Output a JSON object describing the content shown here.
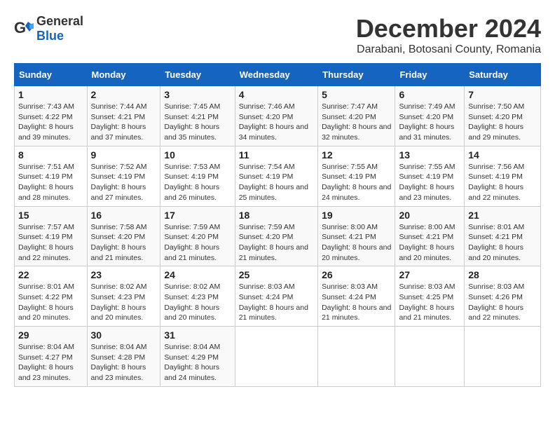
{
  "logo": {
    "text_general": "General",
    "text_blue": "Blue"
  },
  "title": "December 2024",
  "subtitle": "Darabani, Botosani County, Romania",
  "headers": [
    "Sunday",
    "Monday",
    "Tuesday",
    "Wednesday",
    "Thursday",
    "Friday",
    "Saturday"
  ],
  "weeks": [
    [
      {
        "day": "1",
        "sunrise": "7:43 AM",
        "sunset": "4:22 PM",
        "daylight": "8 hours and 39 minutes."
      },
      {
        "day": "2",
        "sunrise": "7:44 AM",
        "sunset": "4:21 PM",
        "daylight": "8 hours and 37 minutes."
      },
      {
        "day": "3",
        "sunrise": "7:45 AM",
        "sunset": "4:21 PM",
        "daylight": "8 hours and 35 minutes."
      },
      {
        "day": "4",
        "sunrise": "7:46 AM",
        "sunset": "4:20 PM",
        "daylight": "8 hours and 34 minutes."
      },
      {
        "day": "5",
        "sunrise": "7:47 AM",
        "sunset": "4:20 PM",
        "daylight": "8 hours and 32 minutes."
      },
      {
        "day": "6",
        "sunrise": "7:49 AM",
        "sunset": "4:20 PM",
        "daylight": "8 hours and 31 minutes."
      },
      {
        "day": "7",
        "sunrise": "7:50 AM",
        "sunset": "4:20 PM",
        "daylight": "8 hours and 29 minutes."
      }
    ],
    [
      {
        "day": "8",
        "sunrise": "7:51 AM",
        "sunset": "4:19 PM",
        "daylight": "8 hours and 28 minutes."
      },
      {
        "day": "9",
        "sunrise": "7:52 AM",
        "sunset": "4:19 PM",
        "daylight": "8 hours and 27 minutes."
      },
      {
        "day": "10",
        "sunrise": "7:53 AM",
        "sunset": "4:19 PM",
        "daylight": "8 hours and 26 minutes."
      },
      {
        "day": "11",
        "sunrise": "7:54 AM",
        "sunset": "4:19 PM",
        "daylight": "8 hours and 25 minutes."
      },
      {
        "day": "12",
        "sunrise": "7:55 AM",
        "sunset": "4:19 PM",
        "daylight": "8 hours and 24 minutes."
      },
      {
        "day": "13",
        "sunrise": "7:55 AM",
        "sunset": "4:19 PM",
        "daylight": "8 hours and 23 minutes."
      },
      {
        "day": "14",
        "sunrise": "7:56 AM",
        "sunset": "4:19 PM",
        "daylight": "8 hours and 22 minutes."
      }
    ],
    [
      {
        "day": "15",
        "sunrise": "7:57 AM",
        "sunset": "4:19 PM",
        "daylight": "8 hours and 22 minutes."
      },
      {
        "day": "16",
        "sunrise": "7:58 AM",
        "sunset": "4:20 PM",
        "daylight": "8 hours and 21 minutes."
      },
      {
        "day": "17",
        "sunrise": "7:59 AM",
        "sunset": "4:20 PM",
        "daylight": "8 hours and 21 minutes."
      },
      {
        "day": "18",
        "sunrise": "7:59 AM",
        "sunset": "4:20 PM",
        "daylight": "8 hours and 21 minutes."
      },
      {
        "day": "19",
        "sunrise": "8:00 AM",
        "sunset": "4:21 PM",
        "daylight": "8 hours and 20 minutes."
      },
      {
        "day": "20",
        "sunrise": "8:00 AM",
        "sunset": "4:21 PM",
        "daylight": "8 hours and 20 minutes."
      },
      {
        "day": "21",
        "sunrise": "8:01 AM",
        "sunset": "4:21 PM",
        "daylight": "8 hours and 20 minutes."
      }
    ],
    [
      {
        "day": "22",
        "sunrise": "8:01 AM",
        "sunset": "4:22 PM",
        "daylight": "8 hours and 20 minutes."
      },
      {
        "day": "23",
        "sunrise": "8:02 AM",
        "sunset": "4:23 PM",
        "daylight": "8 hours and 20 minutes."
      },
      {
        "day": "24",
        "sunrise": "8:02 AM",
        "sunset": "4:23 PM",
        "daylight": "8 hours and 20 minutes."
      },
      {
        "day": "25",
        "sunrise": "8:03 AM",
        "sunset": "4:24 PM",
        "daylight": "8 hours and 21 minutes."
      },
      {
        "day": "26",
        "sunrise": "8:03 AM",
        "sunset": "4:24 PM",
        "daylight": "8 hours and 21 minutes."
      },
      {
        "day": "27",
        "sunrise": "8:03 AM",
        "sunset": "4:25 PM",
        "daylight": "8 hours and 21 minutes."
      },
      {
        "day": "28",
        "sunrise": "8:03 AM",
        "sunset": "4:26 PM",
        "daylight": "8 hours and 22 minutes."
      }
    ],
    [
      {
        "day": "29",
        "sunrise": "8:04 AM",
        "sunset": "4:27 PM",
        "daylight": "8 hours and 23 minutes."
      },
      {
        "day": "30",
        "sunrise": "8:04 AM",
        "sunset": "4:28 PM",
        "daylight": "8 hours and 23 minutes."
      },
      {
        "day": "31",
        "sunrise": "8:04 AM",
        "sunset": "4:29 PM",
        "daylight": "8 hours and 24 minutes."
      },
      null,
      null,
      null,
      null
    ]
  ],
  "labels": {
    "sunrise": "Sunrise:",
    "sunset": "Sunset:",
    "daylight": "Daylight:"
  }
}
